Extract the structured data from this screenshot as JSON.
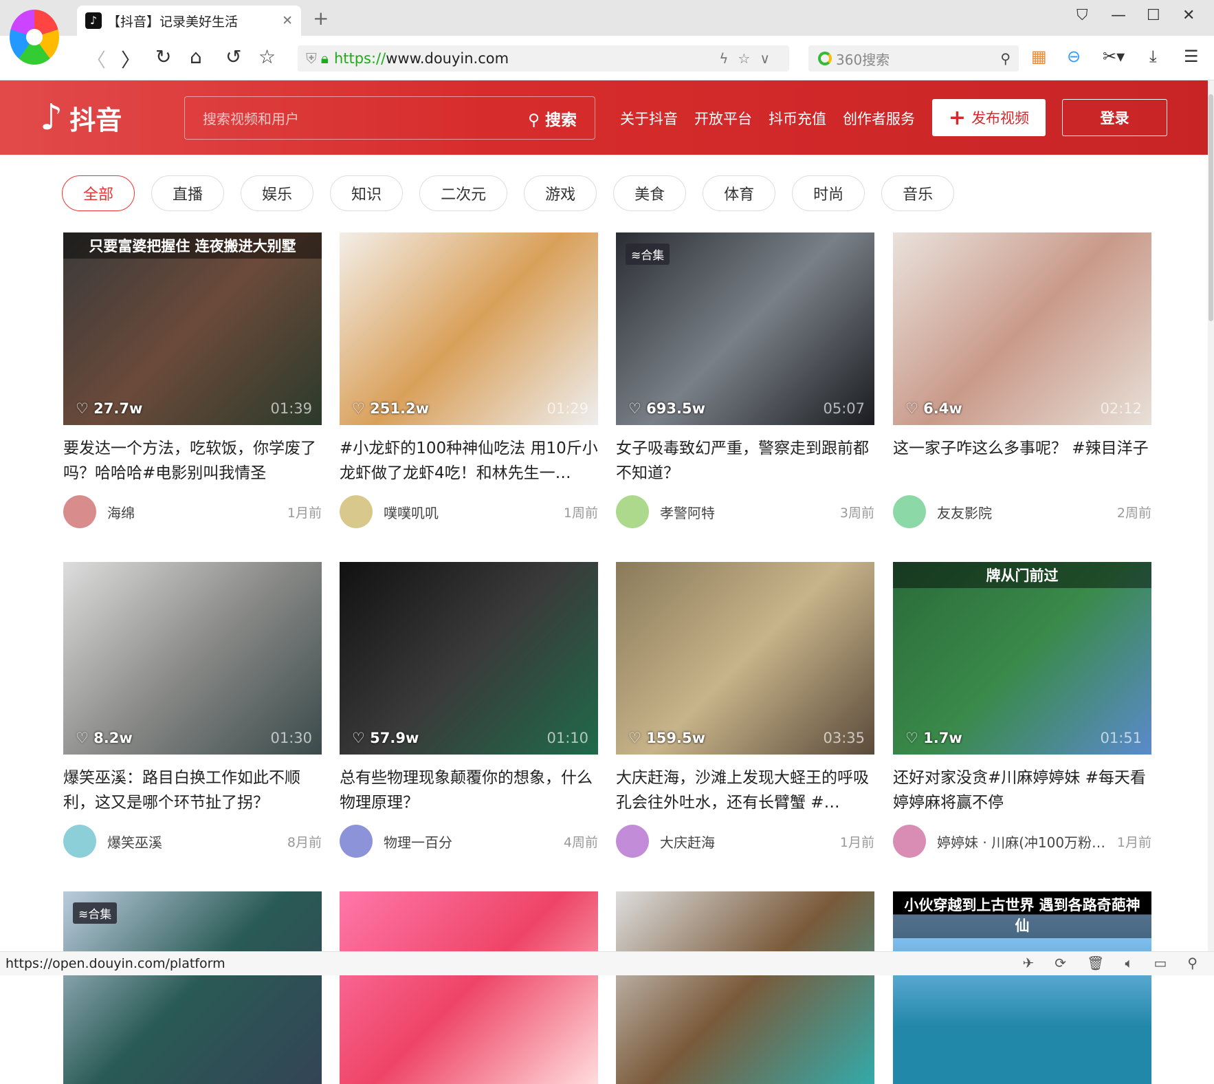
{
  "browser": {
    "tab_title": "【抖音】记录美好生活",
    "url_scheme": "https://",
    "url_rest": "www.douyin.com",
    "search_placeholder": "360搜索",
    "status_url": "https://open.douyin.com/platform"
  },
  "header": {
    "logo_text": "抖音",
    "search_placeholder": "搜索视频和用户",
    "search_button": "搜索",
    "links": [
      "关于抖音",
      "开放平台",
      "抖币充值",
      "创作者服务"
    ],
    "publish": "发布视频",
    "login": "登录"
  },
  "categories": [
    "全部",
    "直播",
    "娱乐",
    "知识",
    "二次元",
    "游戏",
    "美食",
    "体育",
    "时尚",
    "音乐"
  ],
  "videos": [
    {
      "overlay": "只要富婆把握住 连夜搬进大别墅",
      "likes": "27.7w",
      "duration": "01:39",
      "title": "要发达一个方法，吃软饭，你学废了吗？哈哈哈#电影别叫我情圣",
      "author": "海绵",
      "time": "1月前"
    },
    {
      "likes": "251.2w",
      "duration": "01:29",
      "title": "#小龙虾的100种神仙吃法 用10斤小龙虾做了龙虾4吃！和林先生一…",
      "author": "噗噗叽叽",
      "time": "1周前"
    },
    {
      "badge": "合集",
      "likes": "693.5w",
      "duration": "05:07",
      "title": "女子吸毒致幻严重，警察走到跟前都不知道？",
      "author": "孝警阿特",
      "time": "3周前"
    },
    {
      "likes": "6.4w",
      "duration": "02:12",
      "title": "这一家子咋这么多事呢？ #辣目洋子",
      "author": "友友影院",
      "time": "2周前"
    },
    {
      "likes": "8.2w",
      "duration": "01:30",
      "title": "爆笑巫溪：路目白换工作如此不顺利，这又是哪个环节扯了拐？",
      "author": "爆笑巫溪",
      "time": "8月前"
    },
    {
      "likes": "57.9w",
      "duration": "01:10",
      "title": "总有些物理现象颠覆你的想象，什么物理原理？",
      "author": "物理一百分",
      "time": "4周前"
    },
    {
      "likes": "159.5w",
      "duration": "03:35",
      "title": "大庆赶海，沙滩上发现大蛏王的呼吸孔会往外吐水，还有长臂蟹 #…",
      "author": "大庆赶海",
      "time": "1月前"
    },
    {
      "overlay": "牌从门前过",
      "likes": "1.7w",
      "duration": "01:51",
      "title": "还好对家没贪#川麻婷婷妹 #每天看婷婷麻将赢不停",
      "author": "婷婷妹 · 川麻(冲100万粉…",
      "time": "1月前"
    },
    {
      "badge": "合集"
    },
    {},
    {},
    {
      "overlay": "小伙穿越到上古世界 遇到各路奇葩神仙"
    }
  ],
  "colors": {
    "brand": "#d72c2c",
    "active_pill": "#e33333"
  }
}
